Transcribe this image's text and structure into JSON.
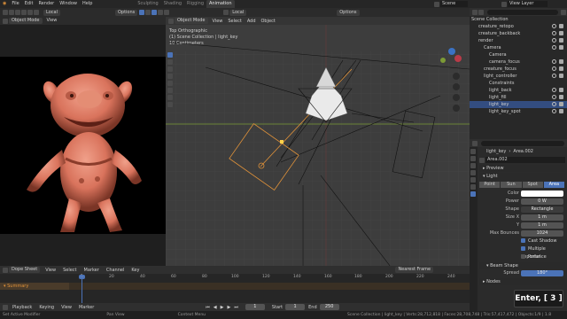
{
  "topbar": {
    "menus": [
      "File",
      "Edit",
      "Render",
      "Window",
      "Help"
    ],
    "workspaces": [
      "Sculpting",
      "Shading",
      "Rigging",
      "Animation"
    ],
    "active_workspace": "Animation",
    "scene": "Scene",
    "view_layer": "View Layer"
  },
  "left_header": {
    "mode": "Object Mode",
    "menus": [
      "View"
    ]
  },
  "viewport": {
    "mode": "Object Mode",
    "menus": [
      "View",
      "Select",
      "Add",
      "Object"
    ],
    "orientation": "Local",
    "options": "Options",
    "overlay": [
      "Top Orthographic",
      "(1) Scene Collection | light_key",
      "10 Centimeters"
    ]
  },
  "upper_toolbar": {
    "orientation": "Local",
    "options": "Options"
  },
  "outliner": {
    "root": "Scene Collection",
    "items": [
      {
        "label": "creature_retopo",
        "selected": false
      },
      {
        "label": "creature_backback",
        "selected": false
      },
      {
        "label": "render",
        "selected": false
      },
      {
        "label": "Camera",
        "selected": false
      },
      {
        "label": "Camera",
        "selected": false
      },
      {
        "label": "camera_focus",
        "selected": false
      },
      {
        "label": "creature_focus",
        "selected": false
      },
      {
        "label": "light_controller",
        "selected": false
      },
      {
        "label": "Constraints",
        "selected": false
      },
      {
        "label": "light_back",
        "selected": false
      },
      {
        "label": "light_fill",
        "selected": false
      },
      {
        "label": "light_key",
        "selected": true
      },
      {
        "label": "light_key_spot",
        "selected": false
      }
    ]
  },
  "properties": {
    "object": "light_key",
    "data": "Area.002",
    "data_field": "Area.002",
    "preview": "Preview",
    "light_section": "Light",
    "light_types": [
      "Point",
      "Sun",
      "Spot",
      "Area"
    ],
    "active_type": "Area",
    "color_label": "Color",
    "power_label": "Power",
    "power": "0 W",
    "shape_label": "Shape",
    "shape": "Rectangle",
    "size_x_label": "Size X",
    "size_x": "1 m",
    "y_label": "Y",
    "size_y": "1 m",
    "max_bounces_label": "Max Bounces",
    "max_bounces": "1024",
    "cast_shadow": "Cast Shadow",
    "multiple_importance": "Multiple Importance",
    "portal": "Portal",
    "beam_shape": "Beam Shape",
    "spread_label": "Spread",
    "spread": "180°",
    "nodes": "Nodes"
  },
  "dopesheet": {
    "editor": "Dope Sheet",
    "menus": [
      "View",
      "Select",
      "Marker",
      "Channel",
      "Key"
    ],
    "snap": "Nearest Frame",
    "summary": "Summary",
    "current_frame": "1",
    "ticks": [
      "1",
      "20",
      "40",
      "60",
      "80",
      "100",
      "120",
      "140",
      "160",
      "180",
      "200",
      "220",
      "240"
    ]
  },
  "playback": {
    "menus": [
      "Playback",
      "Keying",
      "View",
      "Marker"
    ],
    "frame": "1",
    "start_label": "Start",
    "start": "1",
    "end_label": "End",
    "end": "250"
  },
  "statusbar": {
    "left": "Set Active Modifier",
    "mid1": "Pan View",
    "mid2": "Context Menu",
    "stats": "Scene Collection | light_key | Verts:28,712,818 | Faces:28,708,748 | Tris:57,417,472 | Objects:1/9 | 1.8"
  },
  "key_overlay": "Enter, [ 3 ]",
  "colors": {
    "accent": "#4b73b8",
    "selected_orange": "#e0923a",
    "creature": "#d9735c",
    "grid_x": "#a23b3b",
    "grid_y": "#7c9a36"
  }
}
